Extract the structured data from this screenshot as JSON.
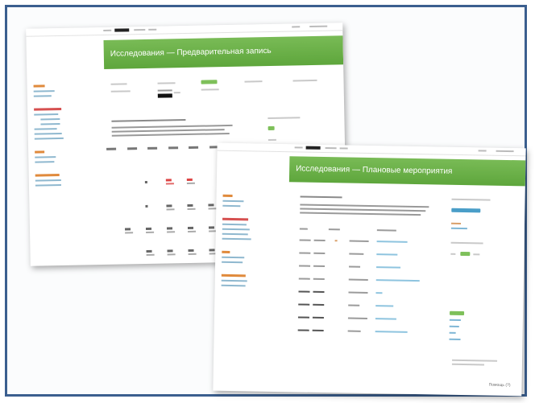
{
  "back_page": {
    "title": "Исследования — Предварительная запись"
  },
  "front_page": {
    "title": "Исследования — Плановые мероприятия",
    "footer": "Помощь (?)"
  },
  "colors": {
    "frame": "#3b5f8f",
    "header_green": "#6aaf47",
    "link_blue": "#7fb7d6",
    "accent_orange": "#e08a3c"
  }
}
